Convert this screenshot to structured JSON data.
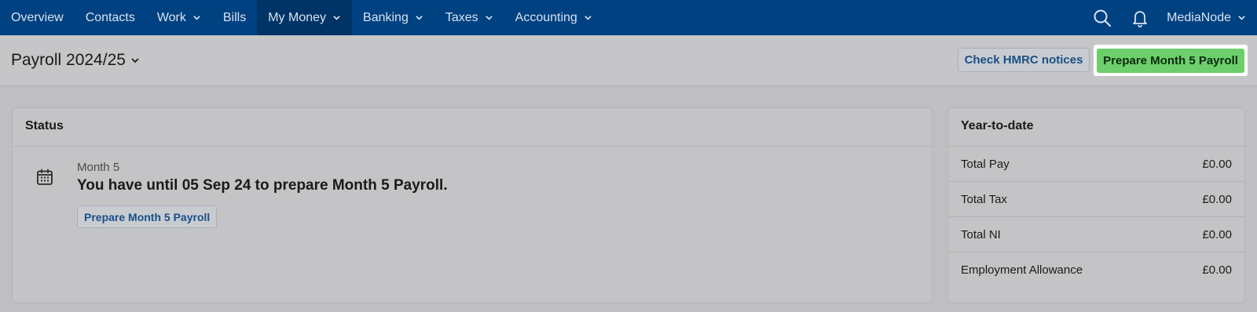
{
  "nav": {
    "items": [
      {
        "label": "Overview",
        "dropdown": false
      },
      {
        "label": "Contacts",
        "dropdown": false
      },
      {
        "label": "Work",
        "dropdown": true
      },
      {
        "label": "Bills",
        "dropdown": false
      },
      {
        "label": "My Money",
        "dropdown": true
      },
      {
        "label": "Banking",
        "dropdown": true
      },
      {
        "label": "Taxes",
        "dropdown": true
      },
      {
        "label": "Accounting",
        "dropdown": true
      }
    ],
    "active_item": "My Money",
    "user": "MediaNode",
    "icons": [
      "search-icon",
      "bell-icon"
    ]
  },
  "header": {
    "title": "Payroll 2024/25",
    "check_hmrc_label": "Check HMRC notices",
    "prepare_label": "Prepare Month 5 Payroll"
  },
  "status": {
    "heading": "Status",
    "month": "Month 5",
    "message": "You have until 05 Sep 24 to prepare Month 5 Payroll.",
    "button_label": "Prepare Month 5 Payroll"
  },
  "ytd": {
    "heading": "Year-to-date",
    "rows": [
      {
        "label": "Total Pay",
        "value": "£0.00"
      },
      {
        "label": "Total Tax",
        "value": "£0.00"
      },
      {
        "label": "Total NI",
        "value": "£0.00"
      },
      {
        "label": "Employment Allowance",
        "value": "£0.00"
      }
    ]
  },
  "colors": {
    "nav_bg": "#004182",
    "nav_active": "#003466",
    "primary_button": "#6ccf6c",
    "link": "#1b4f86"
  }
}
